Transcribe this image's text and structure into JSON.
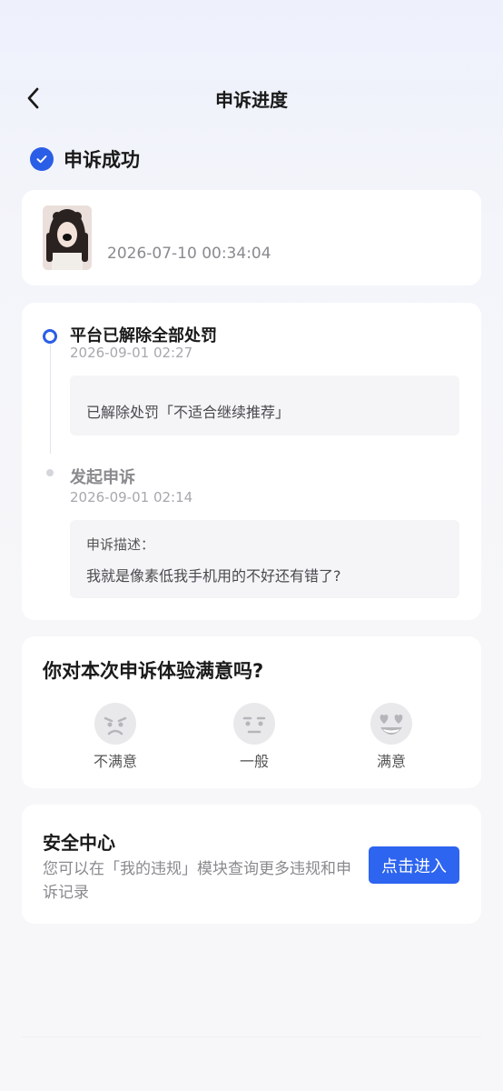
{
  "header": {
    "title": "申诉进度",
    "back_icon": "chevron-left-icon"
  },
  "status": {
    "text": "申诉成功",
    "icon": "check-circle-icon",
    "color": "#2b5ee6"
  },
  "post": {
    "time": "2026-07-10 00:34:04"
  },
  "timeline": [
    {
      "title": "平台已解除全部处罚",
      "time": "2026-09-01 02:27",
      "detail": "已解除处罚「不适合继续推荐」"
    },
    {
      "title": "发起申诉",
      "time": "2026-09-01 02:14",
      "detail_label": "申诉描述：",
      "detail": "我就是像素低我手机用的不好还有错了?"
    }
  ],
  "survey": {
    "question": "你对本次申诉体验满意吗?",
    "options": [
      {
        "label": "不满意",
        "icon": "angry-face-icon"
      },
      {
        "label": "一般",
        "icon": "neutral-face-icon"
      },
      {
        "label": "满意",
        "icon": "heart-eyes-face-icon"
      }
    ]
  },
  "security": {
    "title": "安全中心",
    "desc": "您可以在「我的违规」模块查询更多违规和申诉记录",
    "button": "点击进入"
  },
  "colors": {
    "accent": "#2d64f0",
    "muted_text": "#8a8a8f"
  }
}
